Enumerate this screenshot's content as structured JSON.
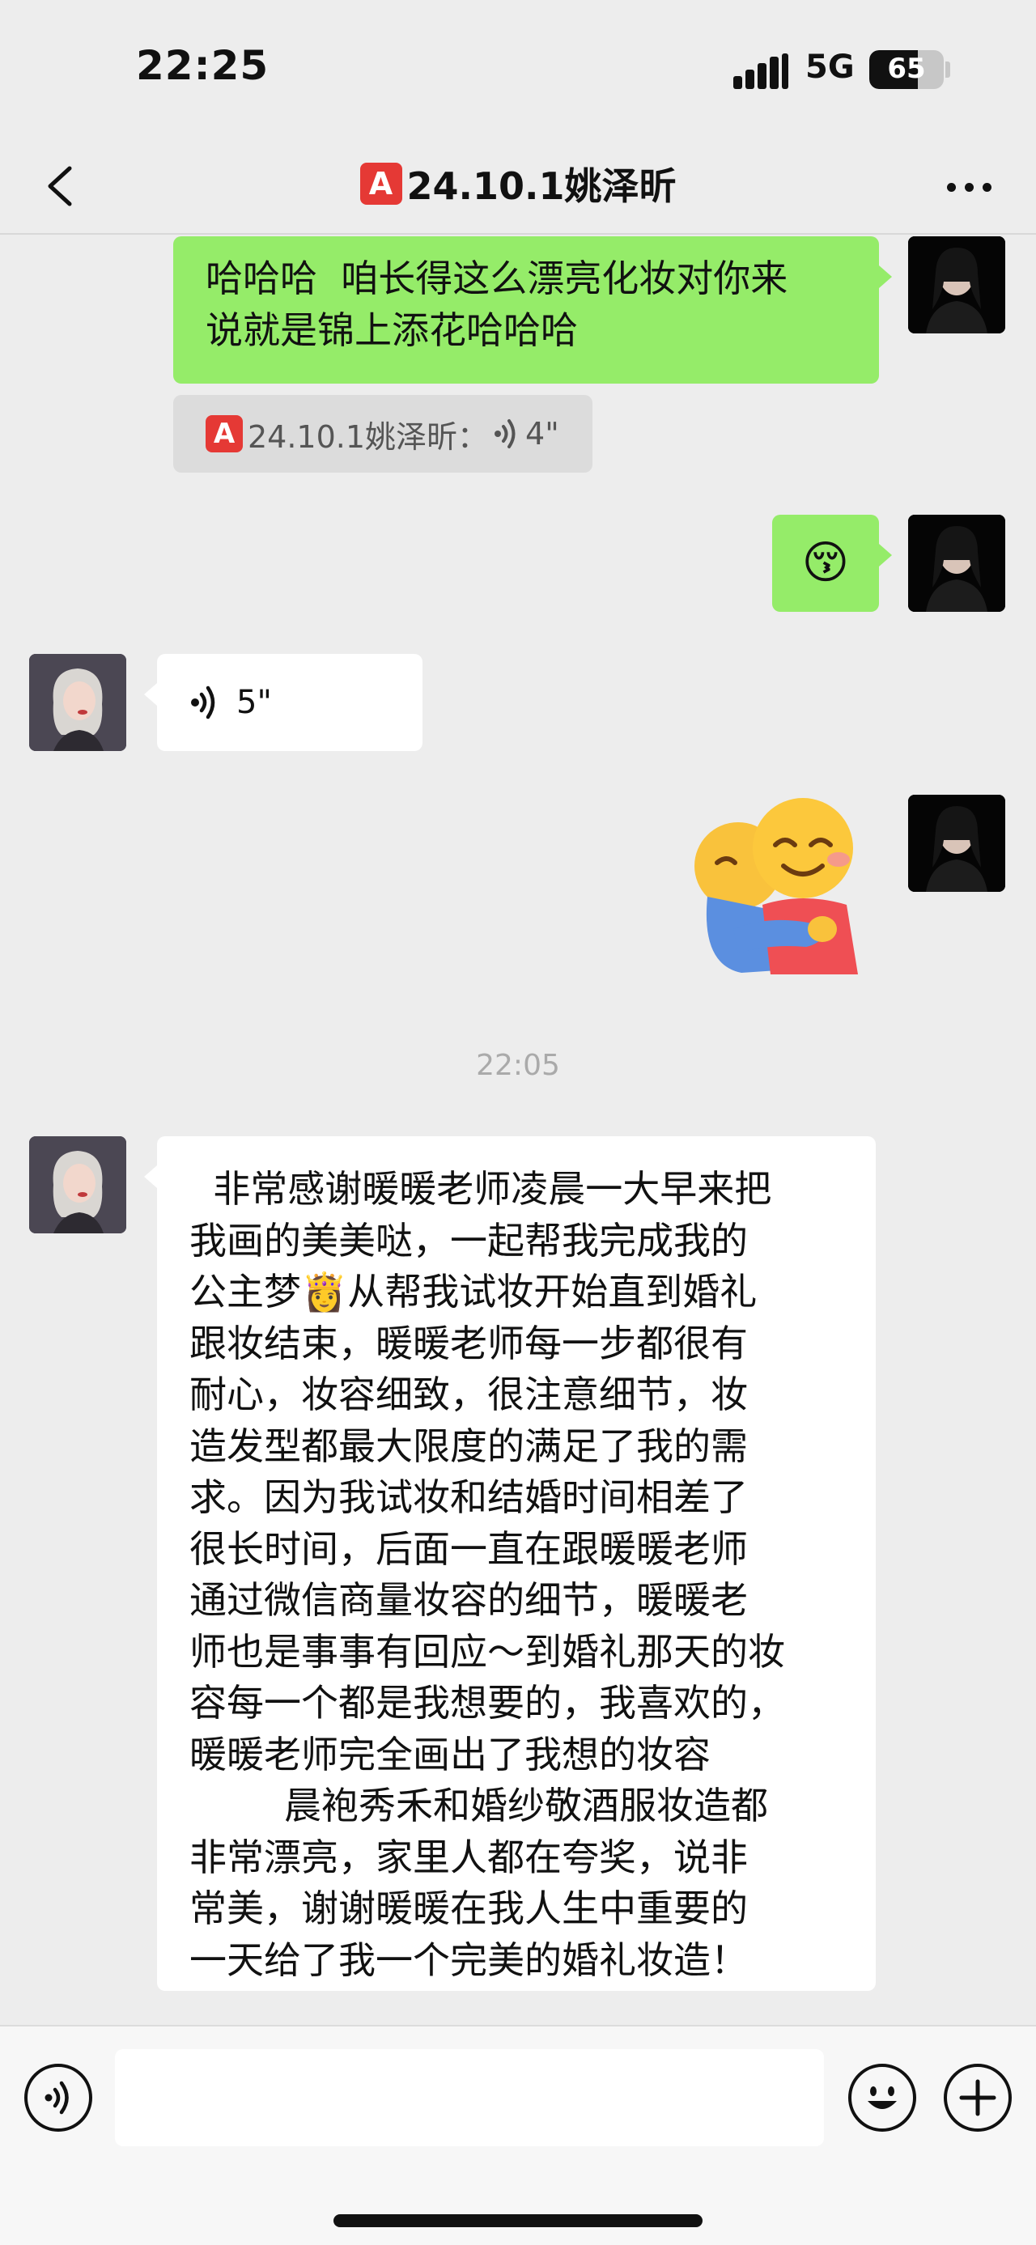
{
  "status_bar": {
    "time": "22:25",
    "network": "5G",
    "battery": "65",
    "battery_level_percent": 65
  },
  "nav": {
    "badge": "A",
    "title": "24.10.1姚泽昕",
    "back_icon": "chevron-left-icon",
    "more_icon": "more-dots-icon"
  },
  "messages": {
    "m1": {
      "text": "哈哈哈  咱长得这么漂亮化妆对你来\n说就是锦上添花哈哈哈"
    },
    "m1_quote": {
      "badge": "A",
      "name": "24.10.1姚泽昕：",
      "duration": "4\""
    },
    "m2": {
      "emoji": "😚"
    },
    "m3": {
      "duration": "5\""
    },
    "m4": {
      "sticker": "🤗"
    },
    "timestamp": "22:05",
    "m5": {
      "text": "  非常感谢暖暖老师凌晨一大早来把\n我画的美美哒，一起帮我完成我的\n公主梦👸从帮我试妆开始直到婚礼\n跟妆结束，暖暖老师每一步都很有\n耐心，妆容细致，很注意细节，妆\n造发型都最大限度的满足了我的需\n求。因为我试妆和结婚时间相差了\n很长时间，后面一直在跟暖暖老师\n通过微信商量妆容的细节，暖暖老\n师也是事事有回应～到婚礼那天的妆\n容每一个都是我想要的，我喜欢的，\n暖暖老师完全画出了我想的妆容\n        晨袍秀禾和婚纱敬酒服妆造都\n非常漂亮，家里人都在夸奖，说非\n常美，谢谢暖暖在我人生中重要的\n一天给了我一个完美的婚礼妆造！"
    }
  },
  "input_bar": {
    "voice_icon": "voice-mode-icon",
    "emoji_icon": "emoji-smile-icon",
    "plus_icon": "plus-icon",
    "value": ""
  }
}
